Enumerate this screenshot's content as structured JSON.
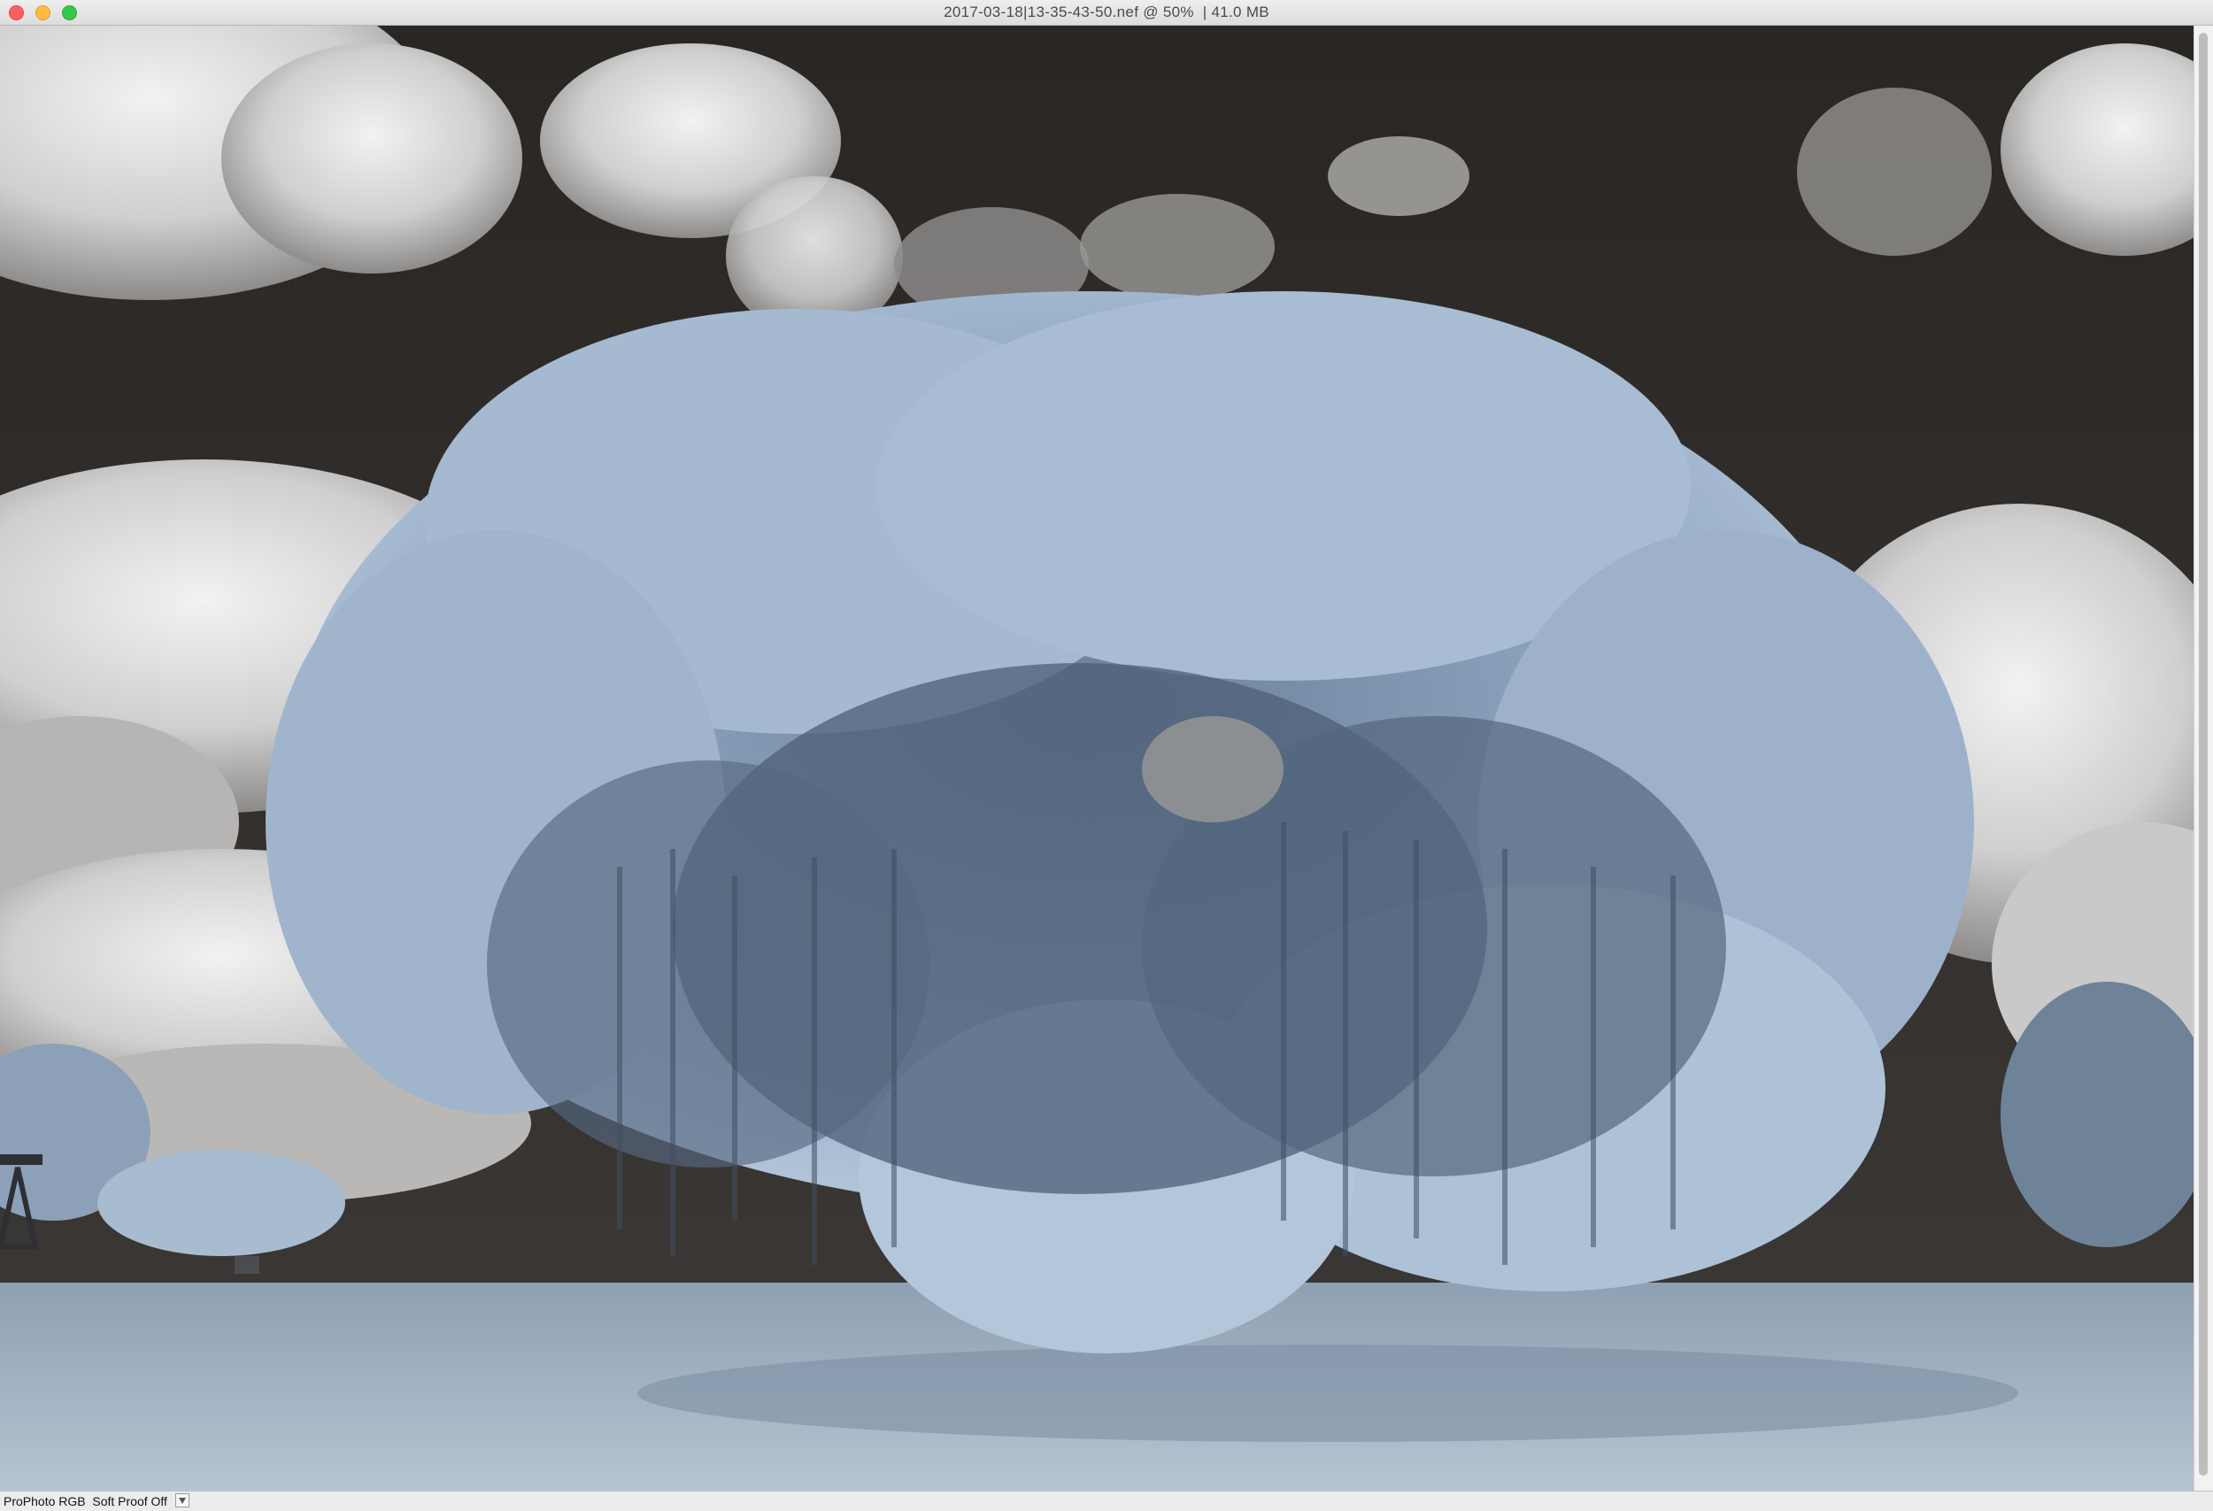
{
  "window": {
    "title": "2017-03-18|13-35-43-50.nef @ 50%  | 41.0 MB"
  },
  "status": {
    "text": "ProPhoto RGB  Soft Proof Off",
    "menu_icon": "triangle-down-icon"
  },
  "photo": {
    "description_icon": "infrared-tree-photo",
    "colors": {
      "sky": "#322e2c",
      "cloud": "#d6d6d6",
      "foliage": "#9fb6cf",
      "foliage_dark": "#4e6078",
      "ground": "#a7b6c6"
    }
  }
}
